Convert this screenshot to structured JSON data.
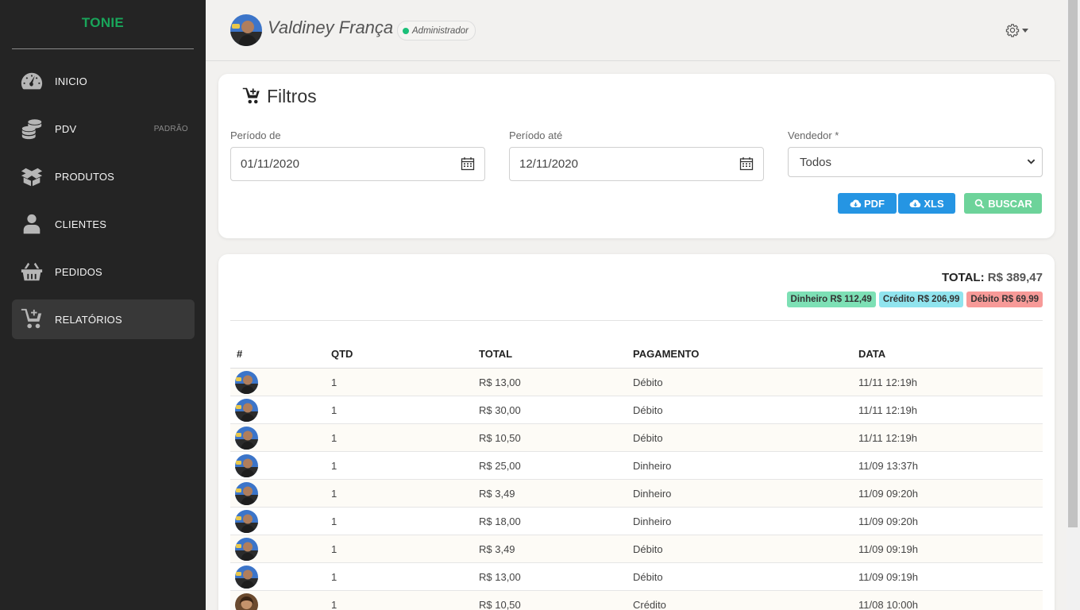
{
  "brand": "TONIE",
  "sidebar": {
    "items": [
      {
        "label": "INICIO",
        "icon": "speedometer-icon",
        "badge": ""
      },
      {
        "label": "PDV",
        "icon": "coins-icon",
        "badge": "PADRÃO"
      },
      {
        "label": "PRODUTOS",
        "icon": "box-icon",
        "badge": ""
      },
      {
        "label": "CLIENTES",
        "icon": "user-icon",
        "badge": ""
      },
      {
        "label": "PEDIDOS",
        "icon": "basket-icon",
        "badge": ""
      },
      {
        "label": "RELATÓRIOS",
        "icon": "cart-plus-icon",
        "badge": "",
        "active": true
      }
    ]
  },
  "header": {
    "user_name": "Valdiney França",
    "role": "Administrador",
    "role_color": "#1bbf79"
  },
  "filters": {
    "title": "Filtros",
    "period_from_label": "Período de",
    "period_from_value": "01/11/2020",
    "period_to_label": "Período até",
    "period_to_value": "12/11/2020",
    "seller_label": "Vendedor *",
    "seller_value": "Todos",
    "pdf_label": "PDF",
    "xls_label": "XLS",
    "search_label": "BUSCAR"
  },
  "results": {
    "total_label": "TOTAL:",
    "total_value": "R$ 389,47",
    "chips": [
      {
        "label": "Dinheiro R$ 112,49",
        "color": "#7de0b5"
      },
      {
        "label": "Crédito R$ 206,99",
        "color": "#90e4ee"
      },
      {
        "label": "Débito R$ 69,99",
        "color": "#f79a98"
      }
    ],
    "columns": [
      "#",
      "QTD",
      "TOTAL",
      "PAGAMENTO",
      "DATA"
    ],
    "rows": [
      {
        "avatar": "man",
        "qtd": "1",
        "total": "R$ 13,00",
        "payment": "Débito",
        "date": "11/11 12:19h"
      },
      {
        "avatar": "man",
        "qtd": "1",
        "total": "R$ 30,00",
        "payment": "Débito",
        "date": "11/11 12:19h"
      },
      {
        "avatar": "man",
        "qtd": "1",
        "total": "R$ 10,50",
        "payment": "Débito",
        "date": "11/11 12:19h"
      },
      {
        "avatar": "man",
        "qtd": "1",
        "total": "R$ 25,00",
        "payment": "Dinheiro",
        "date": "11/09 13:37h"
      },
      {
        "avatar": "man",
        "qtd": "1",
        "total": "R$ 3,49",
        "payment": "Dinheiro",
        "date": "11/09 09:20h"
      },
      {
        "avatar": "man",
        "qtd": "1",
        "total": "R$ 18,00",
        "payment": "Dinheiro",
        "date": "11/09 09:20h"
      },
      {
        "avatar": "man",
        "qtd": "1",
        "total": "R$ 3,49",
        "payment": "Débito",
        "date": "11/09 09:19h"
      },
      {
        "avatar": "man",
        "qtd": "1",
        "total": "R$ 13,00",
        "payment": "Débito",
        "date": "11/09 09:19h"
      },
      {
        "avatar": "woman",
        "qtd": "1",
        "total": "R$ 10,50",
        "payment": "Crédito",
        "date": "11/08 10:00h"
      }
    ]
  }
}
